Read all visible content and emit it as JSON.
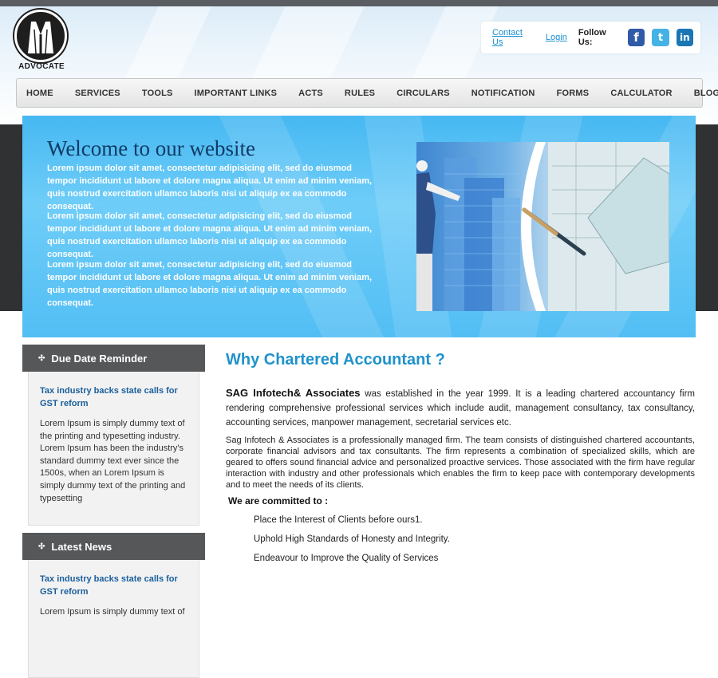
{
  "logo": {
    "text": "ADVOCATE"
  },
  "toplinks": {
    "contact": "Contact Us",
    "login": "Login",
    "follow": "Follow Us:",
    "social": [
      {
        "name": "facebook",
        "glyph": "f"
      },
      {
        "name": "twitter",
        "glyph": "t"
      },
      {
        "name": "linkedin",
        "glyph": "in"
      }
    ]
  },
  "nav": {
    "items": [
      "HOME",
      "SERVICES",
      "TOOLS",
      "IMPORTANT LINKS",
      "ACTS",
      "RULES",
      "CIRCULARS",
      "NOTIFICATION",
      "FORMS",
      "CALCULATOR",
      "BLOGS"
    ]
  },
  "banner": {
    "title": "Welcome to our website",
    "paragraphs": [
      "Lorem ipsum dolor sit amet, consectetur adipisicing elit, sed do eiusmod tempor incididunt ut labore et dolore magna aliqua. Ut enim ad minim veniam, quis nostrud exercitation ullamco laboris nisi ut aliquip ex ea commodo consequat.",
      "Lorem ipsum dolor sit amet, consectetur adipisicing elit, sed do eiusmod tempor incididunt ut labore et dolore magna aliqua. Ut enim ad minim veniam, quis nostrud exercitation ullamco laboris nisi ut aliquip ex ea commodo consequat.",
      "Lorem ipsum dolor sit amet, consectetur adipisicing elit, sed do eiusmod tempor incididunt ut labore et dolore magna aliqua. Ut enim ad minim veniam, quis nostrud exercitation ullamco laboris nisi ut aliquip ex ea commodo consequat."
    ]
  },
  "sidebar": {
    "due": {
      "heading": "Due Date Reminder",
      "link": "Tax industry backs state calls for GST reform",
      "text": "Lorem Ipsum is simply dummy text of the printing and typesetting industry. Lorem Ipsum has been the industry's standard dummy text ever since the 1500s, when an Lorem Ipsum is simply dummy text of the printing and typesetting"
    },
    "news": {
      "heading": "Latest News",
      "link": "Tax industry backs state calls for GST reform",
      "text": "Lorem Ipsum is simply dummy text of"
    }
  },
  "main": {
    "title": "Why Chartered Accountant ?",
    "company": "SAG Infotech& Associates",
    "para1_rest": " was established in the year 1999. It  is a leading chartered accountancy firm rendering comprehensive professional services which include audit, management consultancy, tax consultancy, accounting services, manpower management, secretarial services etc.",
    "para2": "Sag Infotech & Associates is a professionally managed firm. The team consists of distinguished chartered accountants, corporate financial advisors and tax consultants. The firm represents a combination of specialized skills, which are geared to offers sound financial advice and personalized proactive services. Those associated with the firm have regular interaction with industry and other professionals which enables the firm to keep pace with contemporary developments and to meet the needs of its clients.",
    "committed_heading": "We are committed to :",
    "commitments": [
      "Place the Interest of Clients before ours1.",
      "Uphold High Standards of Honesty and Integrity.",
      "Endeavour to Improve the Quality of Services"
    ]
  },
  "colors": {
    "nav_bg": "#e9e9e9",
    "banner_blue": "#52bef4",
    "title_blue": "#1e92cb",
    "link_blue": "#1a5f9c",
    "side_head": "#555759"
  }
}
